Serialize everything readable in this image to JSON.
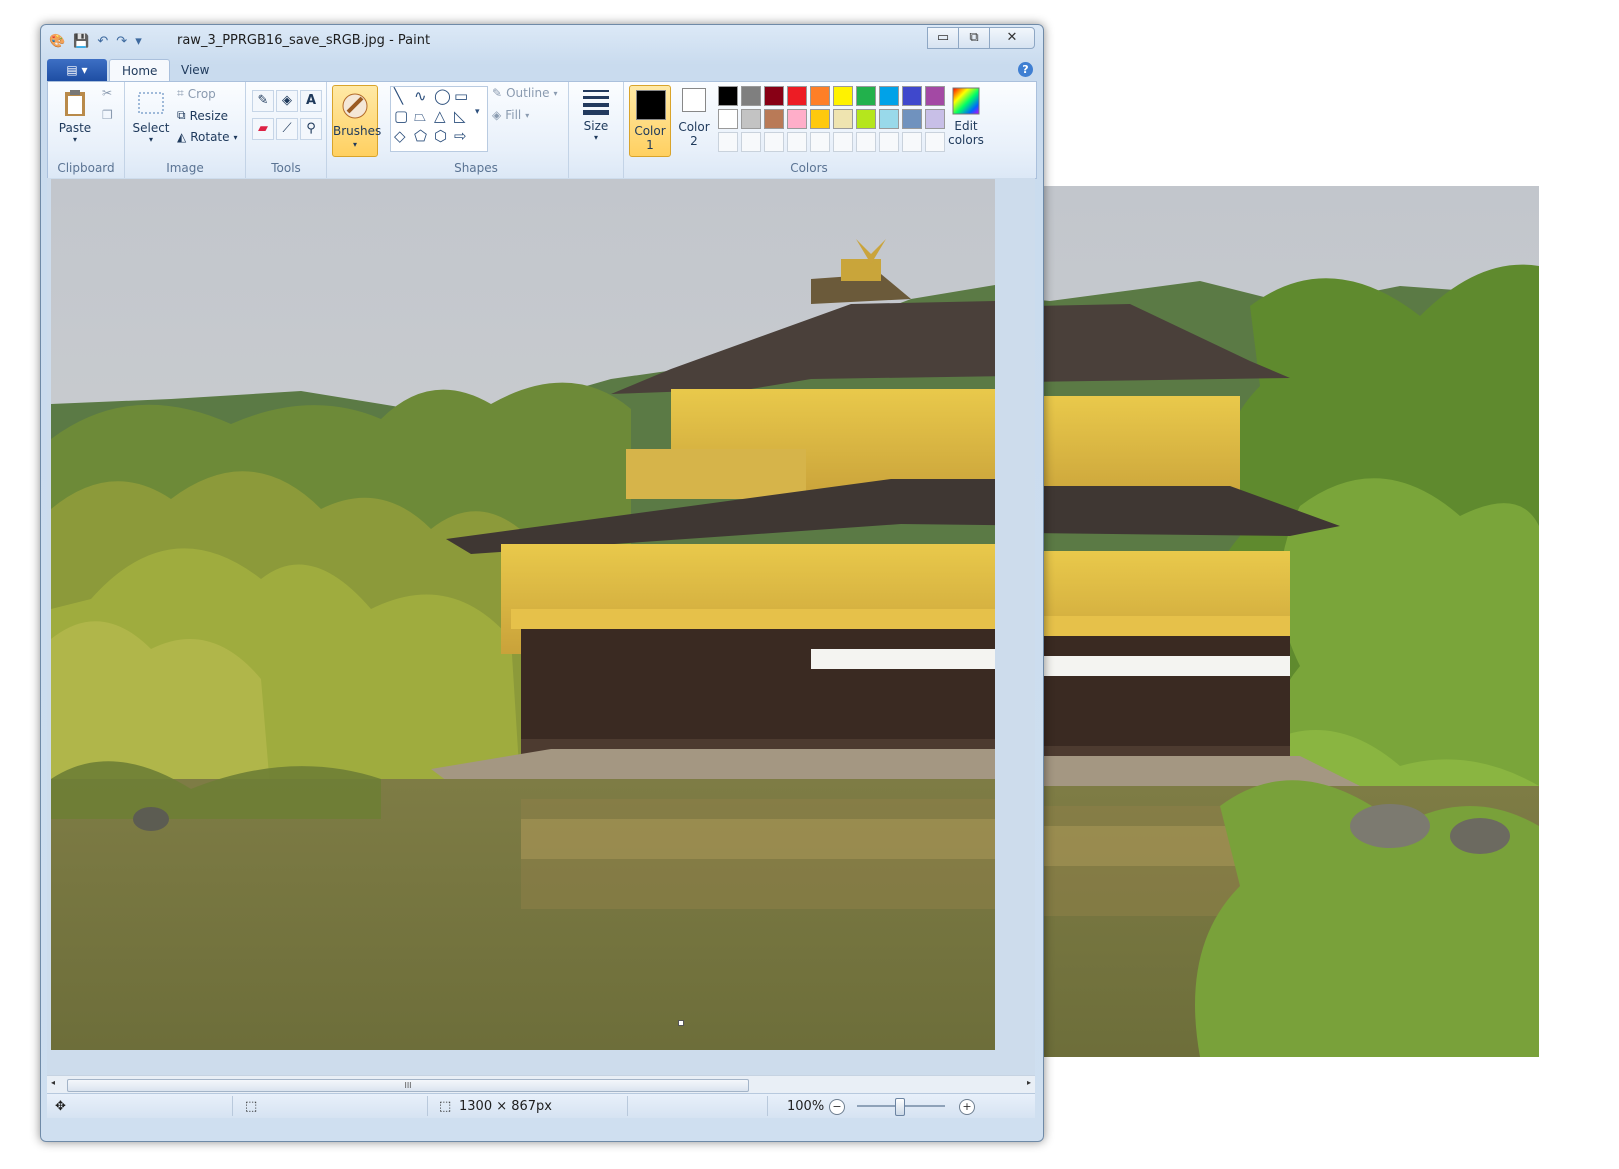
{
  "window": {
    "title": "raw_3_PPRGB16_save_sRGB.jpg - Paint",
    "minimize": "▭",
    "restore": "⧉",
    "close": "✕"
  },
  "quick_access": {
    "save": "💾",
    "undo": "↶",
    "redo": "↷",
    "customize": "▾"
  },
  "tabs": {
    "app_menu": "▤ ▾",
    "home": "Home",
    "view": "View",
    "help": "?"
  },
  "ribbon": {
    "clipboard": {
      "label": "Clipboard",
      "paste": "Paste"
    },
    "image": {
      "label": "Image",
      "select": "Select",
      "crop": "Crop",
      "resize": "Resize",
      "rotate": "Rotate"
    },
    "tools": {
      "label": "Tools"
    },
    "brushes": {
      "label": "Brushes"
    },
    "shapes": {
      "label": "Shapes",
      "outline": "Outline",
      "fill": "Fill"
    },
    "size": {
      "label": "Size"
    },
    "colors": {
      "label": "Colors",
      "color1_line1": "Color",
      "color1_line2": "1",
      "color2_line1": "Color",
      "color2_line2": "2",
      "edit_line1": "Edit",
      "edit_line2": "colors",
      "color1_value": "#000000",
      "color2_value": "#ffffff",
      "row1": [
        "#000000",
        "#7f7f7f",
        "#880015",
        "#ed1c24",
        "#ff7f27",
        "#fff200",
        "#22b14c",
        "#00a2e8",
        "#3f48cc",
        "#a349a4"
      ],
      "row2": [
        "#ffffff",
        "#c3c3c3",
        "#b97a57",
        "#ffaec9",
        "#ffc90e",
        "#efe4b0",
        "#b5e61d",
        "#99d9ea",
        "#7092be",
        "#c8bfe7"
      ]
    }
  },
  "status": {
    "dimensions": "1300 × 867px",
    "zoom": "100%",
    "zoom_out": "−",
    "zoom_in": "+",
    "scroll_grip": "III",
    "left_arrow": "◂",
    "right_arrow": "▸"
  }
}
